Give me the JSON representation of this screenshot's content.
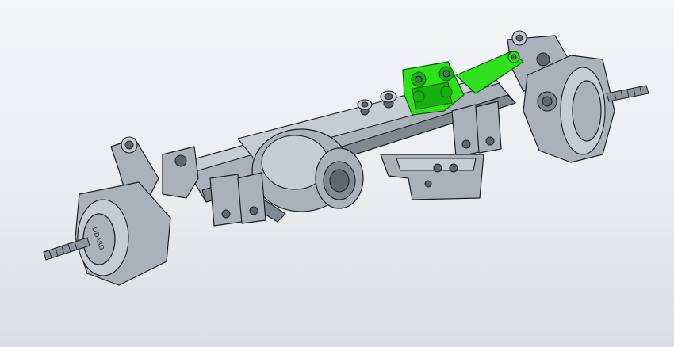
{
  "viewport": {
    "background_top": "#f4f6f8",
    "background_bottom": "#d9dee2"
  },
  "model": {
    "body_color": "#a9b2bb",
    "highlight_color": "#2ee01e",
    "hub_engraving": "LIDARD"
  }
}
